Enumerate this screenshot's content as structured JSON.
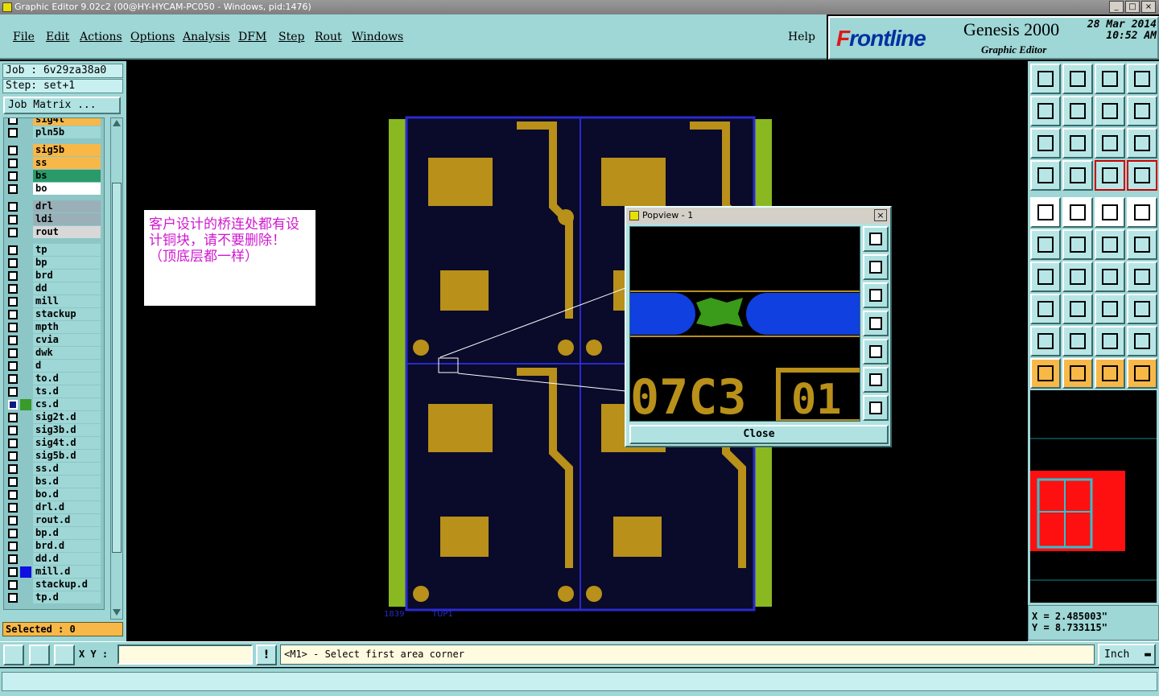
{
  "window": {
    "title": "Graphic Editor 9.02c2 (00@HY-HYCAM-PC050 - Windows, pid:1476)"
  },
  "menu": {
    "items": [
      "File",
      "Edit",
      "Actions",
      "Options",
      "Analysis",
      "DFM",
      "Step",
      "Rout",
      "Windows"
    ],
    "help": "Help"
  },
  "brand": {
    "logo_prefix": "F",
    "logo_rest": "rontline",
    "product": "Genesis 2000",
    "subtitle": "Graphic Editor",
    "date": "28 Mar 2014",
    "time": "10:52 AM"
  },
  "job": {
    "job_line": "Job : 6v29za38a0",
    "step_line": "Step: set+1",
    "job_matrix_label": "Job Matrix ..."
  },
  "layers": [
    {
      "name": "sig4t",
      "color": "#f8b848",
      "group": 0
    },
    {
      "name": "pln5b",
      "color": "#9fd6d6",
      "group": 0
    },
    {
      "name": "sig5b",
      "color": "#f8b848",
      "group": 1
    },
    {
      "name": "ss",
      "color": "#f8b848",
      "group": 1
    },
    {
      "name": "bs",
      "color": "#2a9a6a",
      "group": 1
    },
    {
      "name": "bo",
      "color": "#ffffff",
      "group": 1
    },
    {
      "name": "drl",
      "color": "#9ab0b8",
      "group": 2
    },
    {
      "name": "ldi",
      "color": "#9ab0b8",
      "group": 2
    },
    {
      "name": "rout",
      "color": "#d8d8d8",
      "group": 2
    },
    {
      "name": "tp",
      "color": "#9fd6d6",
      "group": 3
    },
    {
      "name": "bp",
      "color": "#9fd6d6",
      "group": 3
    },
    {
      "name": "brd",
      "color": "#9fd6d6",
      "group": 3
    },
    {
      "name": "dd",
      "color": "#9fd6d6",
      "group": 3
    },
    {
      "name": "mill",
      "color": "#9fd6d6",
      "group": 3
    },
    {
      "name": "stackup",
      "color": "#9fd6d6",
      "group": 3
    },
    {
      "name": "mpth",
      "color": "#9fd6d6",
      "group": 3
    },
    {
      "name": "cvia",
      "color": "#9fd6d6",
      "group": 3
    },
    {
      "name": "dwk",
      "color": "#9fd6d6",
      "group": 3
    },
    {
      "name": "d",
      "color": "#9fd6d6",
      "group": 3
    },
    {
      "name": "to.d",
      "color": "#9fd6d6",
      "group": 3
    },
    {
      "name": "ts.d",
      "color": "#9fd6d6",
      "group": 3
    },
    {
      "name": "cs.d",
      "color": "#9fd6d6",
      "group": 3,
      "selected": true,
      "swatch": "#3a9a2a"
    },
    {
      "name": "sig2t.d",
      "color": "#9fd6d6",
      "group": 3
    },
    {
      "name": "sig3b.d",
      "color": "#9fd6d6",
      "group": 3
    },
    {
      "name": "sig4t.d",
      "color": "#9fd6d6",
      "group": 3
    },
    {
      "name": "sig5b.d",
      "color": "#9fd6d6",
      "group": 3
    },
    {
      "name": "ss.d",
      "color": "#9fd6d6",
      "group": 3
    },
    {
      "name": "bs.d",
      "color": "#9fd6d6",
      "group": 3
    },
    {
      "name": "bo.d",
      "color": "#9fd6d6",
      "group": 3
    },
    {
      "name": "drl.d",
      "color": "#9fd6d6",
      "group": 3
    },
    {
      "name": "rout.d",
      "color": "#9fd6d6",
      "group": 3
    },
    {
      "name": "bp.d",
      "color": "#9fd6d6",
      "group": 3
    },
    {
      "name": "brd.d",
      "color": "#9fd6d6",
      "group": 3
    },
    {
      "name": "dd.d",
      "color": "#9fd6d6",
      "group": 3
    },
    {
      "name": "mill.d",
      "color": "#9fd6d6",
      "group": 3,
      "swatch": "#1010e0"
    },
    {
      "name": "stackup.d",
      "color": "#9fd6d6",
      "group": 3
    },
    {
      "name": "tp.d",
      "color": "#9fd6d6",
      "group": 3
    }
  ],
  "selected_label": "Selected : 0",
  "note": {
    "text": "客户设计的桥连处都有设计铜块，请不要删除！（顶底层都一样）"
  },
  "popview": {
    "title": "Popview - 1",
    "close_label": "Close",
    "board_text": "07C3",
    "board_num": "01"
  },
  "canvas": {
    "label_left": "1839",
    "label_right": "TUP1"
  },
  "colors": {
    "copper": "#b8901a",
    "board": "#0a0a2a",
    "frame": "#8ab820",
    "outline": "#2a2ad0",
    "pad_blue": "#1040e0",
    "green": "#3a9a1a"
  },
  "coords": {
    "x": "X = 2.485003\"",
    "y": "Y = 8.733115\""
  },
  "status": {
    "xy_label": "X Y :",
    "xy_value": "",
    "message": "<M1> - Select first area corner",
    "unit": "Inch"
  }
}
